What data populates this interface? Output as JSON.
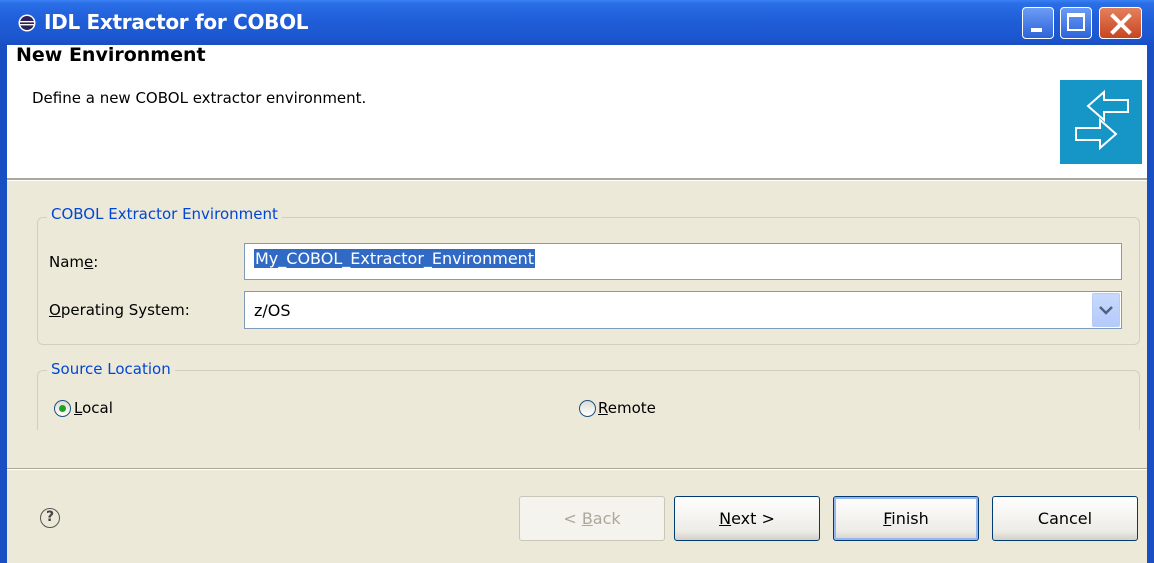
{
  "window": {
    "title": "IDL Extractor for COBOL",
    "controls": [
      "minimize",
      "maximize",
      "close"
    ]
  },
  "header": {
    "title": "New Environment",
    "description": "Define a new COBOL extractor environment.",
    "graphic_icon": "two-arrows-icon"
  },
  "environment_group": {
    "legend": "COBOL Extractor Environment",
    "name_label_pre": "Nam",
    "name_label_mnemonic": "e",
    "name_label_post": ":",
    "name_value": "My_COBOL_Extractor_Environment",
    "os_label_mnemonic": "O",
    "os_label_post": "perating System:",
    "os_value": "z/OS"
  },
  "source_group": {
    "legend": "Source Location",
    "local_mnemonic": "L",
    "local_post": "ocal",
    "local_selected": true,
    "remote_mnemonic": "R",
    "remote_post": "emote",
    "remote_selected": false
  },
  "buttons": {
    "back_pre": "< ",
    "back_mnemonic": "B",
    "back_post": "ack",
    "next_mnemonic": "N",
    "next_post": "ext >",
    "finish_mnemonic": "F",
    "finish_post": "inish",
    "cancel": "Cancel"
  },
  "help": {
    "icon": "help-icon",
    "glyph": "?"
  },
  "colors": {
    "title_bar": "#1f5ed8",
    "legend_text": "#0046d5",
    "selection": "#316ac5",
    "banner_graphic": "#1596c7"
  }
}
